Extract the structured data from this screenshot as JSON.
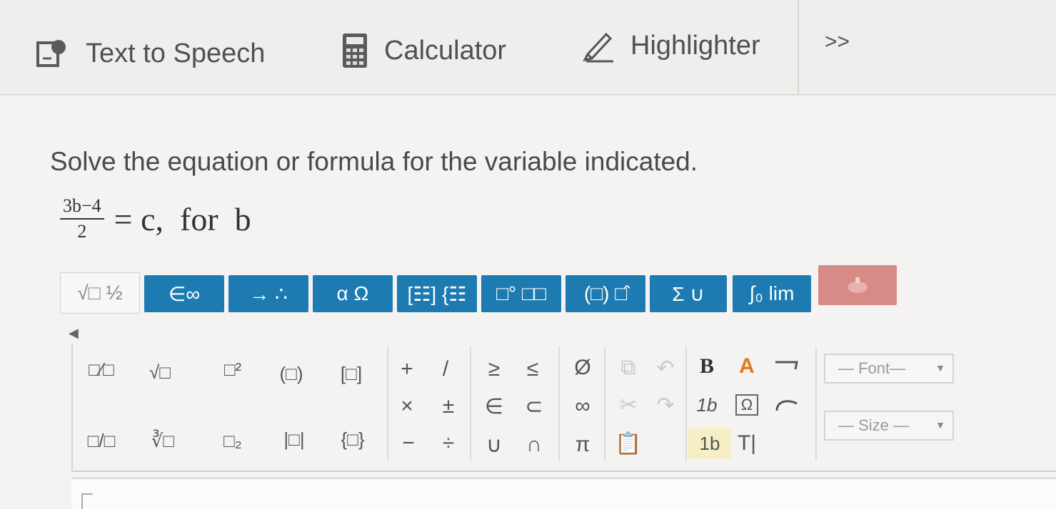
{
  "toolbar": {
    "text_to_speech": "Text to Speech",
    "calculator": "Calculator",
    "highlighter": "Highlighter",
    "more": ">>"
  },
  "question": {
    "instruction": "Solve the equation or formula for the variable indicated.",
    "numerator": "3b−4",
    "denominator": "2",
    "rest": "= c,  for  b"
  },
  "palette_tabs": [
    {
      "label": "√□ ½"
    },
    {
      "label": "∈∞"
    },
    {
      "label": "→ ∴"
    },
    {
      "label": "α Ω"
    },
    {
      "label": "[☷] {☷"
    },
    {
      "label": "□° □□"
    },
    {
      "label": "(□) □̂"
    },
    {
      "label": "Σ ∪"
    },
    {
      "label": "∫₀ lim"
    },
    {
      "label": ""
    }
  ],
  "palette": {
    "fraction": "□⁄□",
    "sqrt": "√□",
    "superscript": "□²",
    "parens": "(□)",
    "brackets": "[□]",
    "mixed_fraction": "□/□",
    "nth_root": "∛□",
    "subscript": "□₂",
    "abs": "|□|",
    "braces": "{□}",
    "plus": "+",
    "slash": "/",
    "times": "×",
    "plusminus": "±",
    "minus": "−",
    "divide": "÷",
    "geq": "≥",
    "leq": "≤",
    "element_of": "∈",
    "subset": "⊂",
    "union": "∪",
    "intersect": "∩",
    "empty_set": "Ø",
    "infinity": "∞",
    "pi": "π",
    "bold": "B",
    "font_a": "A",
    "italic_1b": "1b",
    "omega_box": "Ω",
    "sample_1b": "1b",
    "text_tool": "T|",
    "font_select": "— Font—",
    "size_select": "— Size —"
  }
}
